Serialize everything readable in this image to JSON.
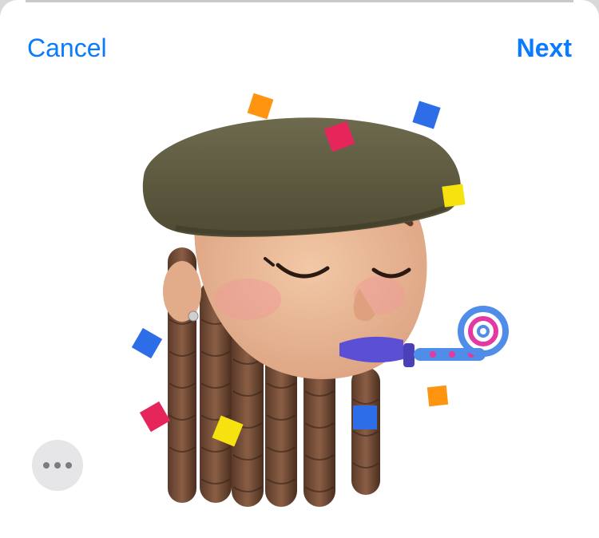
{
  "sheet": {
    "cancel_label": "Cancel",
    "next_label": "Next"
  },
  "sticker": {
    "subject": "memoji-party-horn",
    "confetti_colors": [
      "#ff9410",
      "#e6265a",
      "#2d6ee8",
      "#f6e20e"
    ]
  },
  "more_button": {
    "icon": "ellipsis-icon"
  }
}
